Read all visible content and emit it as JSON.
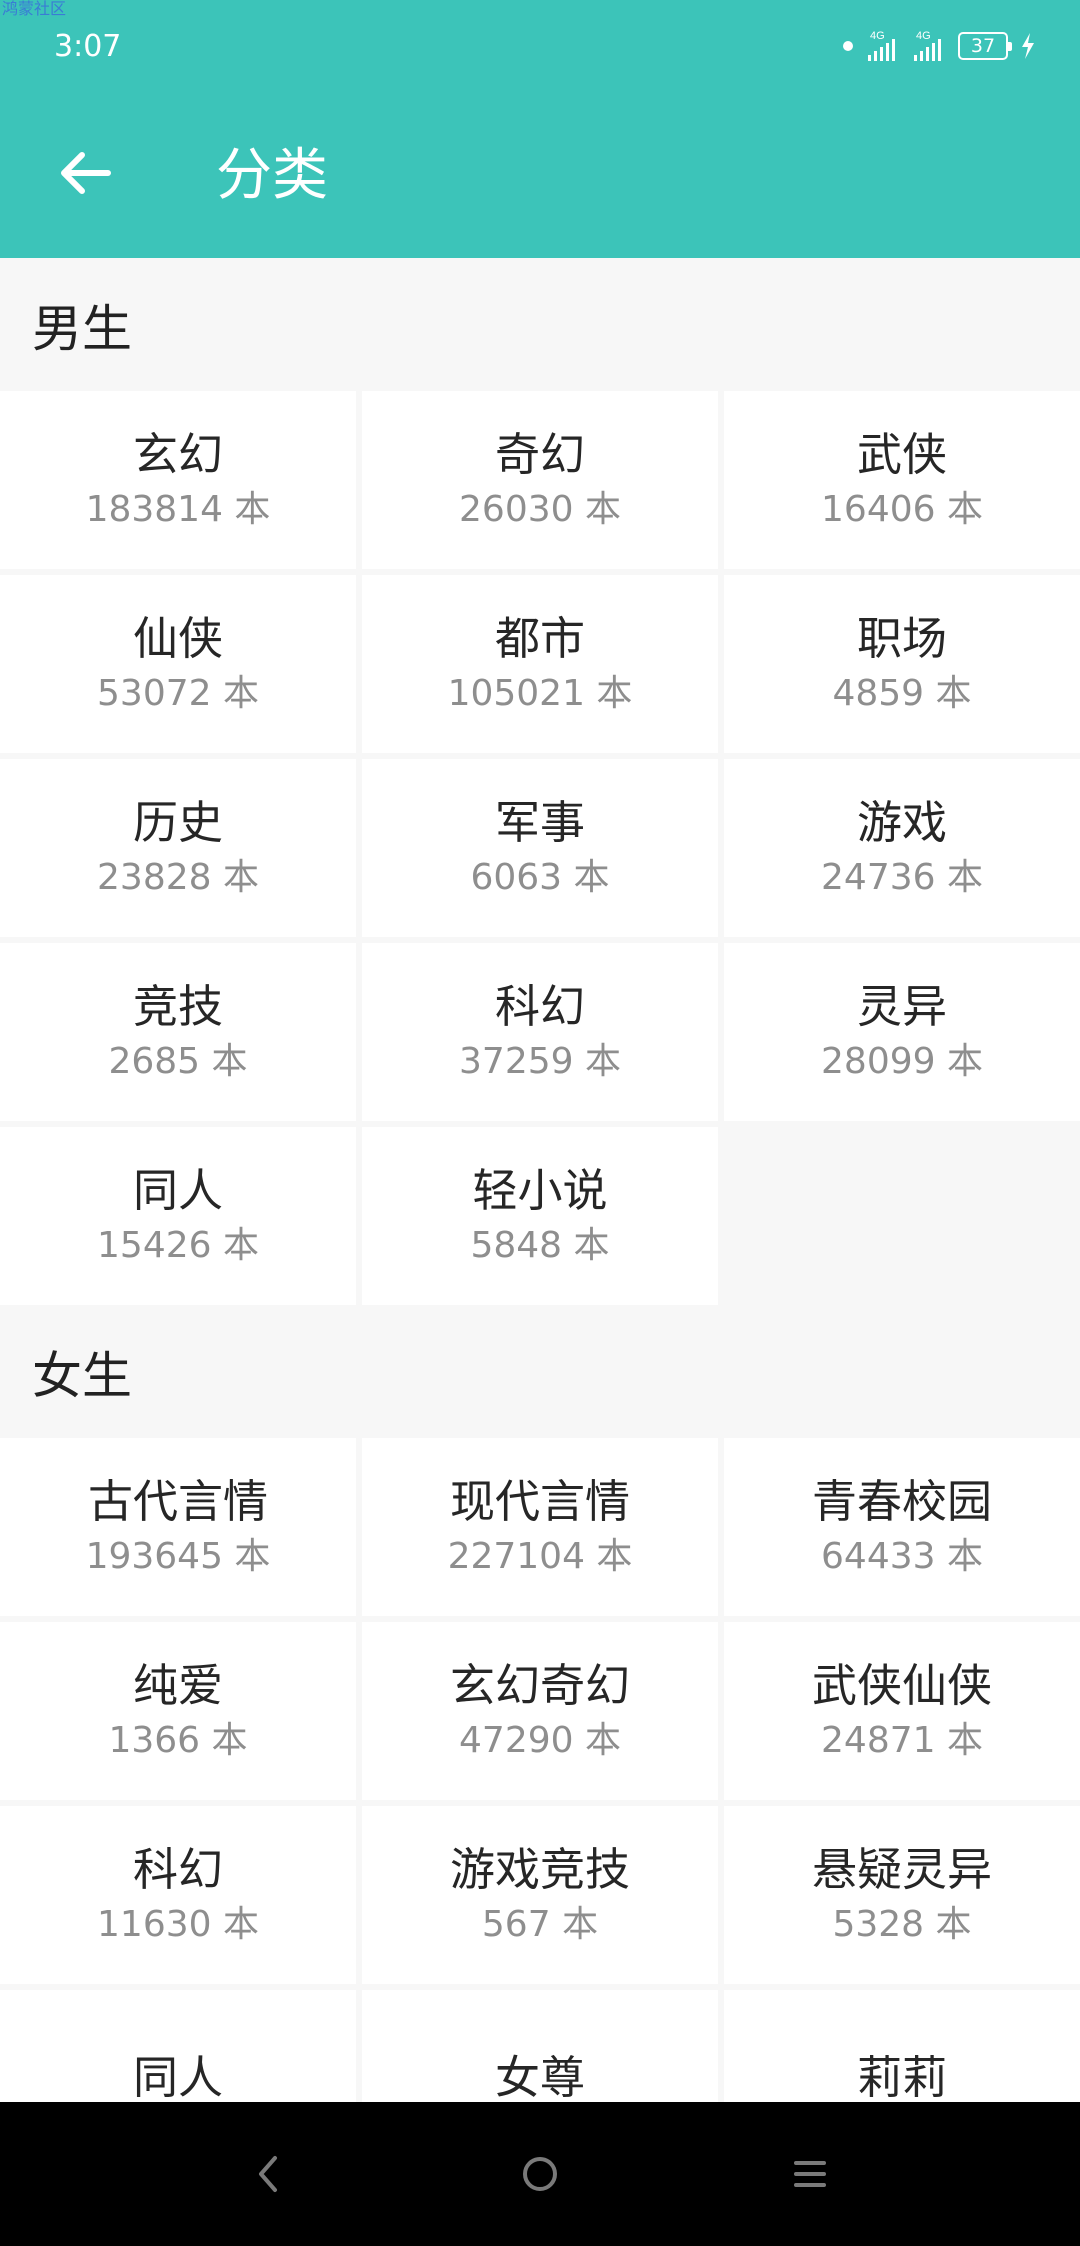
{
  "status_bar": {
    "watermark": "鸿蒙社区",
    "time": "3:07",
    "network_1": "4G",
    "network_2": "4G",
    "battery": "37"
  },
  "header": {
    "title": "分类",
    "back_icon": "arrow-left-icon"
  },
  "sections": [
    {
      "title": "男生",
      "items": [
        {
          "name": "玄幻",
          "count": "183814 本"
        },
        {
          "name": "奇幻",
          "count": "26030 本"
        },
        {
          "name": "武侠",
          "count": "16406 本"
        },
        {
          "name": "仙侠",
          "count": "53072 本"
        },
        {
          "name": "都市",
          "count": "105021 本"
        },
        {
          "name": "职场",
          "count": "4859 本"
        },
        {
          "name": "历史",
          "count": "23828 本"
        },
        {
          "name": "军事",
          "count": "6063 本"
        },
        {
          "name": "游戏",
          "count": "24736 本"
        },
        {
          "name": "竞技",
          "count": "2685 本"
        },
        {
          "name": "科幻",
          "count": "37259 本"
        },
        {
          "name": "灵异",
          "count": "28099 本"
        },
        {
          "name": "同人",
          "count": "15426 本"
        },
        {
          "name": "轻小说",
          "count": "5848 本"
        }
      ]
    },
    {
      "title": "女生",
      "items": [
        {
          "name": "古代言情",
          "count": "193645 本"
        },
        {
          "name": "现代言情",
          "count": "227104 本"
        },
        {
          "name": "青春校园",
          "count": "64433 本"
        },
        {
          "name": "纯爱",
          "count": "1366 本"
        },
        {
          "name": "玄幻奇幻",
          "count": "47290 本"
        },
        {
          "name": "武侠仙侠",
          "count": "24871 本"
        },
        {
          "name": "科幻",
          "count": "11630 本"
        },
        {
          "name": "游戏竞技",
          "count": "567 本"
        },
        {
          "name": "悬疑灵异",
          "count": "5328 本"
        },
        {
          "name": "同人",
          "count": ""
        },
        {
          "name": "女尊",
          "count": ""
        },
        {
          "name": "莉莉",
          "count": ""
        }
      ]
    }
  ],
  "nav_bar": {
    "back_icon": "triangle-back-icon",
    "home_icon": "circle-home-icon",
    "menu_icon": "recents-menu-icon"
  },
  "colors": {
    "accent": "#3cc4b9",
    "background": "#f7f7f7",
    "cell": "#ffffff",
    "count_text": "#8e8e8e"
  }
}
